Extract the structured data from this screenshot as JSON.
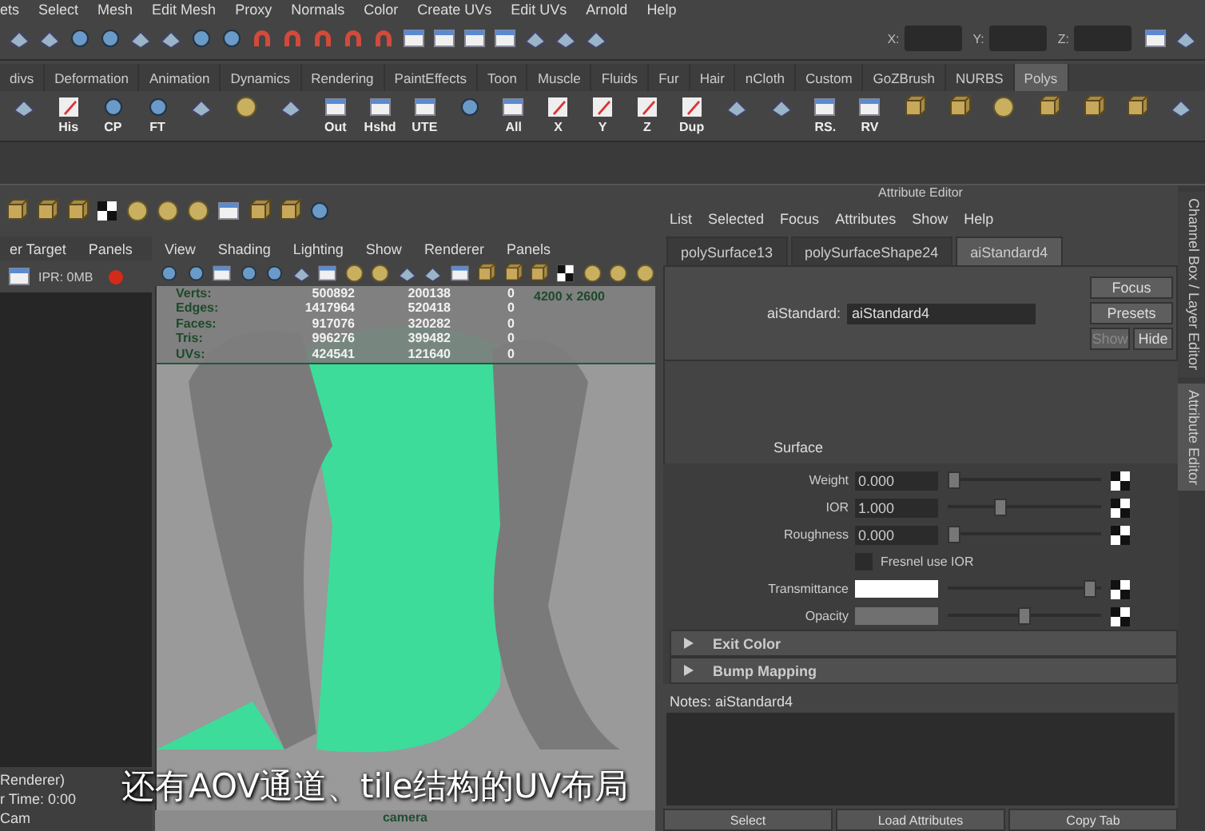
{
  "menu_bar": [
    "ets",
    "Select",
    "Mesh",
    "Edit Mesh",
    "Proxy",
    "Normals",
    "Color",
    "Create UVs",
    "Edit UVs",
    "Arnold",
    "Help"
  ],
  "status_line": {
    "fields": [
      "X:",
      "Y:",
      "Z:"
    ]
  },
  "shelf_tabs": [
    {
      "label": "divs",
      "selected": false
    },
    {
      "label": "Deformation",
      "selected": false
    },
    {
      "label": "Animation",
      "selected": false
    },
    {
      "label": "Dynamics",
      "selected": false
    },
    {
      "label": "Rendering",
      "selected": false
    },
    {
      "label": "PaintEffects",
      "selected": false
    },
    {
      "label": "Toon",
      "selected": false
    },
    {
      "label": "Muscle",
      "selected": false
    },
    {
      "label": "Fluids",
      "selected": false
    },
    {
      "label": "Fur",
      "selected": false
    },
    {
      "label": "Hair",
      "selected": false
    },
    {
      "label": "nCloth",
      "selected": false
    },
    {
      "label": "Custom",
      "selected": false
    },
    {
      "label": "GoZBrush",
      "selected": false
    },
    {
      "label": "NURBS",
      "selected": false
    },
    {
      "label": "Polys",
      "selected": true
    }
  ],
  "shelf_labels": [
    "His",
    "CP",
    "FT",
    "Out",
    "Hshd",
    "UTE",
    "All",
    "X",
    "Y",
    "Z",
    "Dup",
    "RS.",
    "RV"
  ],
  "render_view": {
    "menu": [
      "er Target",
      "Panels"
    ],
    "ipr": "IPR: 0MB",
    "footer": [
      "Renderer)",
      "r Time: 0:00",
      "Cam"
    ]
  },
  "viewport": {
    "menu": [
      "View",
      "Shading",
      "Lighting",
      "Show",
      "Renderer",
      "Panels"
    ],
    "hud": [
      {
        "label": "Verts:",
        "values": [
          "500892",
          "200138",
          "0"
        ]
      },
      {
        "label": "Edges:",
        "values": [
          "1417964",
          "520418",
          "0"
        ]
      },
      {
        "label": "Faces:",
        "values": [
          "917076",
          "320282",
          "0"
        ]
      },
      {
        "label": "Tris:",
        "values": [
          "996276",
          "399482",
          "0"
        ]
      },
      {
        "label": "UVs:",
        "values": [
          "424541",
          "121640",
          "0"
        ]
      }
    ],
    "resolution": "4200 x 2600",
    "camera": "camera"
  },
  "subtitle": "还有AOV通道、tile结构的UV布局",
  "attribute_editor": {
    "title": "Attribute Editor",
    "menu": [
      "List",
      "Selected",
      "Focus",
      "Attributes",
      "Show",
      "Help"
    ],
    "tabs": [
      {
        "label": "polySurface13",
        "selected": false
      },
      {
        "label": "polySurfaceShape24",
        "selected": false
      },
      {
        "label": "aiStandard4",
        "selected": true
      }
    ],
    "node_label": "aiStandard:",
    "node_value": "aiStandard4",
    "buttons": [
      {
        "label": "Focus",
        "disabled": false
      },
      {
        "label": "Presets",
        "disabled": false
      },
      {
        "label": "Show",
        "disabled": true
      },
      {
        "label": "Hide",
        "disabled": false
      }
    ],
    "swatch_label": "Surface",
    "rows": [
      {
        "kind": "number",
        "label": "Weight",
        "value": "0.000",
        "level": 0
      },
      {
        "kind": "number",
        "label": "IOR",
        "value": "1.000",
        "level": 0.33
      },
      {
        "kind": "number",
        "label": "Roughness",
        "value": "0.000",
        "level": 0
      },
      {
        "kind": "checkbox",
        "label": "Fresnel use IOR",
        "checked": false
      },
      {
        "kind": "color",
        "label": "Transmittance",
        "color": "#ffffff",
        "level": 0.97
      },
      {
        "kind": "color",
        "label": "Opacity",
        "color": "#707070",
        "level": 0.5
      }
    ],
    "sections": [
      {
        "label": "Exit Color",
        "expanded": false
      },
      {
        "label": "Bump Mapping",
        "expanded": false
      }
    ],
    "notes_label": "Notes:  aiStandard4",
    "bottom_buttons": [
      "Select",
      "Load Attributes",
      "Copy Tab"
    ]
  },
  "side_tabs": [
    {
      "label": "Channel Box / Layer Editor",
      "selected": false
    },
    {
      "label": "Attribute Editor",
      "selected": true
    }
  ]
}
